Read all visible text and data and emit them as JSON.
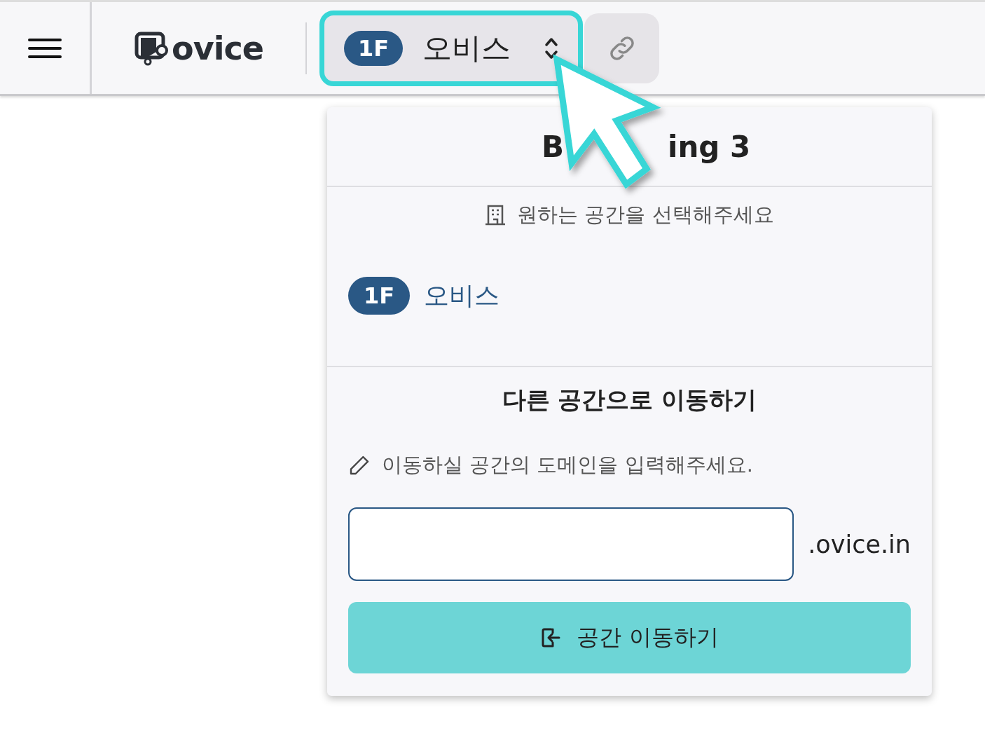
{
  "header": {
    "logo": "ovice",
    "floor_selector": {
      "floor": "1F",
      "name": "오비스",
      "highlighted": true
    }
  },
  "dropdown": {
    "title_parts": [
      "B",
      "ing 3"
    ],
    "prompt": "원하는 공간을 선택해주세요",
    "spaces": [
      {
        "floor": "1F",
        "name": "오비스",
        "selected": true
      }
    ],
    "move_section": {
      "heading": "다른 공간으로 이동하기",
      "hint": "이동하실 공간의 도메인을 입력해주세요.",
      "domain_suffix": ".ovice.in",
      "button": "공간 이동하기"
    }
  }
}
